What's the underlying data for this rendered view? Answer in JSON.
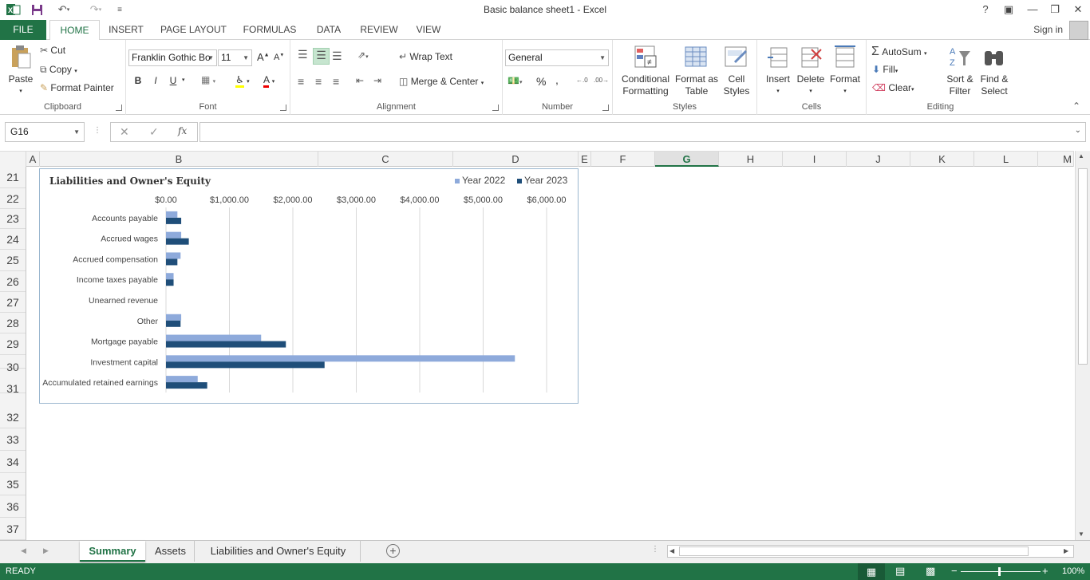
{
  "window": {
    "title": "Basic balance sheet1 - Excel"
  },
  "ribbon_tabs": [
    "FILE",
    "HOME",
    "INSERT",
    "PAGE LAYOUT",
    "FORMULAS",
    "DATA",
    "REVIEW",
    "VIEW"
  ],
  "active_tab": "HOME",
  "account": {
    "sign_in": "Sign in"
  },
  "clipboard": {
    "paste": "Paste",
    "cut": "Cut",
    "copy": "Copy",
    "format_painter": "Format Painter",
    "label": "Clipboard"
  },
  "font": {
    "name": "Franklin Gothic Bo",
    "size": "11",
    "bold": "B",
    "italic": "I",
    "underline": "U",
    "label": "Font"
  },
  "alignment": {
    "wrap_text": "Wrap Text",
    "merge_center": "Merge & Center",
    "label": "Alignment"
  },
  "number": {
    "format": "General",
    "percent": "%",
    "comma": ",",
    "label": "Number"
  },
  "styles": {
    "conditional": "Conditional\nFormatting",
    "format_table": "Format as\nTable",
    "cell_styles": "Cell\nStyles",
    "label": "Styles"
  },
  "cells": {
    "insert": "Insert",
    "delete": "Delete",
    "format": "Format",
    "label": "Cells"
  },
  "editing": {
    "autosum": "AutoSum",
    "fill": "Fill",
    "clear": "Clear",
    "sort_filter": "Sort &\nFilter",
    "find_select": "Find &\nSelect",
    "label": "Editing"
  },
  "formula_bar": {
    "name_box": "G16",
    "fx": "fx",
    "value": ""
  },
  "columns": [
    "A",
    "B",
    "C",
    "D",
    "E",
    "F",
    "G",
    "H",
    "I",
    "J",
    "K",
    "L",
    "M"
  ],
  "selected_column": "G",
  "rows": [
    "21",
    "22",
    "23",
    "24",
    "25",
    "26",
    "27",
    "28",
    "29",
    "30",
    "31",
    "32",
    "33",
    "34",
    "35",
    "36",
    "37"
  ],
  "chart_data": {
    "type": "bar",
    "orientation": "horizontal",
    "title": "Liabilities and Owner's Equity",
    "categories": [
      "Accounts payable",
      "Accrued wages",
      "Accrued compensation",
      "Income taxes payable",
      "Unearned revenue",
      "Other",
      "Mortgage payable",
      "Investment capital",
      "Accumulated retained earnings"
    ],
    "series": [
      {
        "name": "Year 2022",
        "color": "#8eaadb",
        "values": [
          180,
          240,
          230,
          120,
          0,
          240,
          1500,
          5500,
          500
        ]
      },
      {
        "name": "Year 2023",
        "color": "#1f4e79",
        "values": [
          240,
          360,
          180,
          120,
          0,
          230,
          1890,
          2500,
          650
        ]
      }
    ],
    "xlim": [
      0,
      6000
    ],
    "tick_labels": [
      "$0.00",
      "$1,000.00",
      "$2,000.00",
      "$3,000.00",
      "$4,000.00",
      "$5,000.00",
      "$6,000.00"
    ],
    "grid": true,
    "legend": "top-right"
  },
  "sheets": [
    "Summary",
    "Assets",
    "Liabilities and Owner's Equity"
  ],
  "active_sheet": "Summary",
  "status": {
    "mode": "READY",
    "zoom": "100%"
  }
}
